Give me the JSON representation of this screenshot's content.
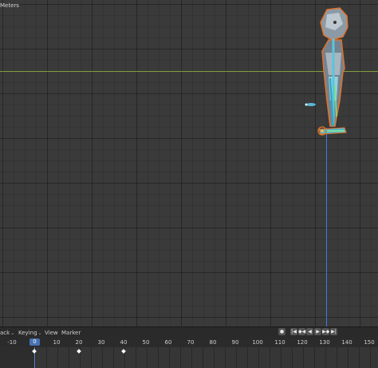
{
  "viewport": {
    "unit_label": "Meters",
    "axis_colors": {
      "x_axis": "#8ba83a",
      "z_axis": "#3d7ee0"
    },
    "selection_outline_color": "#e5722a"
  },
  "timeline": {
    "menus": [
      {
        "label": "ack",
        "has_dropdown": true
      },
      {
        "label": "Keying",
        "has_dropdown": true
      },
      {
        "label": "View",
        "has_dropdown": false
      },
      {
        "label": "Marker",
        "has_dropdown": false
      }
    ],
    "playback": {
      "record": "●",
      "jump_start": "|◀",
      "prev_keyframe": "◆◀",
      "play_reverse": "◀",
      "play": "▶",
      "next_keyframe": "▶◆",
      "jump_end": "▶|"
    },
    "current_frame": "0",
    "ruler_ticks": [
      "-10",
      "10",
      "20",
      "30",
      "40",
      "50",
      "60",
      "70",
      "80",
      "90",
      "100",
      "110",
      "120",
      "130",
      "140",
      "150"
    ],
    "keyframes": [
      0,
      20,
      40
    ]
  }
}
